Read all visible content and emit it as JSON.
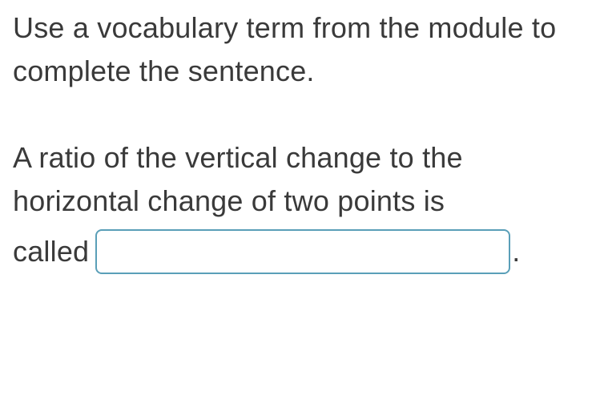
{
  "instruction": "Use a vocabulary term from the module to complete the sentence.",
  "question": {
    "part1": "A ratio of the vertical change to the",
    "part2": "horizontal change of two points is",
    "part3": "called",
    "period": ".",
    "answer_value": "",
    "answer_placeholder": ""
  }
}
